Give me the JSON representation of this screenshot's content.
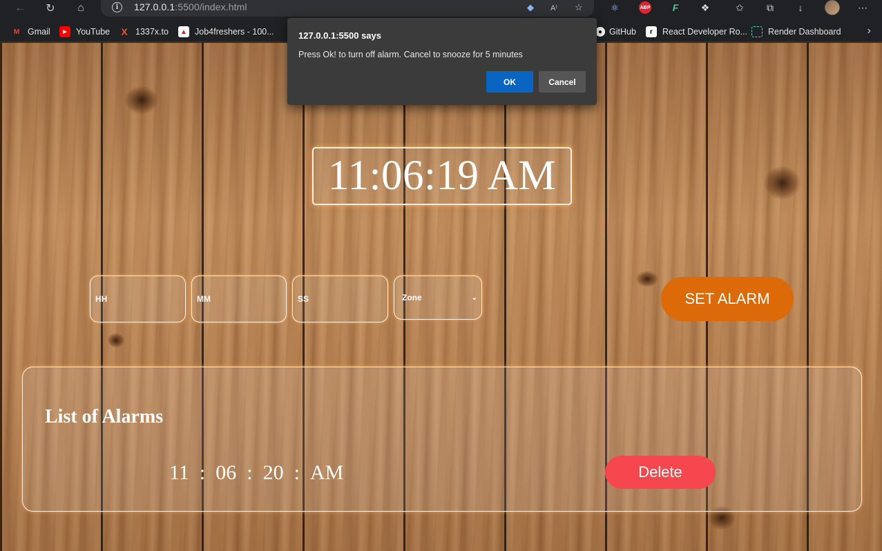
{
  "browser": {
    "url_host": "127.0.0.1",
    "url_rest": ":5500/index.html",
    "icons": {
      "back": "back-arrow-icon",
      "reload": "reload-icon",
      "home": "home-icon",
      "info": "info-icon",
      "tag": "tag-icon",
      "read_aloud": "read-aloud-icon",
      "favorite_add": "add-favorite-icon",
      "react_devtools": "react-devtools-icon",
      "adblock": "adblock-plus-icon",
      "extension_f": "extension-icon",
      "puzzle": "extensions-puzzle-icon",
      "favorites": "favorites-icon",
      "collections": "collections-icon",
      "download": "download-icon",
      "profile": "profile-avatar",
      "menu": "more-menu-icon"
    },
    "adblock_text": "ABP",
    "bookmarks": [
      {
        "label": "Gmail",
        "icon": "gmail-icon"
      },
      {
        "label": "YouTube",
        "icon": "youtube-icon"
      },
      {
        "label": "1337x.to",
        "icon": "1337x-icon"
      },
      {
        "label": "Job4freshers - 100...",
        "icon": "job4freshers-icon"
      },
      {
        "label": "GitHub",
        "icon": "github-icon"
      },
      {
        "label": "React Developer Ro...",
        "icon": "react-roadmap-icon"
      },
      {
        "label": "Render Dashboard",
        "icon": "render-icon"
      }
    ]
  },
  "dialog": {
    "title": "127.0.0.1:5500 says",
    "message": "Press Ok! to turn off alarm. Cancel to snooze for 5 minutes",
    "ok_label": "OK",
    "cancel_label": "Cancel",
    "ok_color": "#0a65c2"
  },
  "clock": {
    "time": "11:06:19 AM"
  },
  "alarm_form": {
    "hh_placeholder": "HH",
    "mm_placeholder": "MM",
    "ss_placeholder": "SS",
    "zone_selected": "Zone",
    "set_alarm_label": "SET ALARM",
    "set_alarm_color": "#dc6a08"
  },
  "alarm_list": {
    "title": "List of Alarms",
    "alarms": [
      {
        "hh": "11",
        "mm": "06",
        "ss": "20",
        "zone": "AM",
        "sep": ":",
        "delete_label": "Delete"
      }
    ],
    "delete_color": "#f5474d"
  }
}
